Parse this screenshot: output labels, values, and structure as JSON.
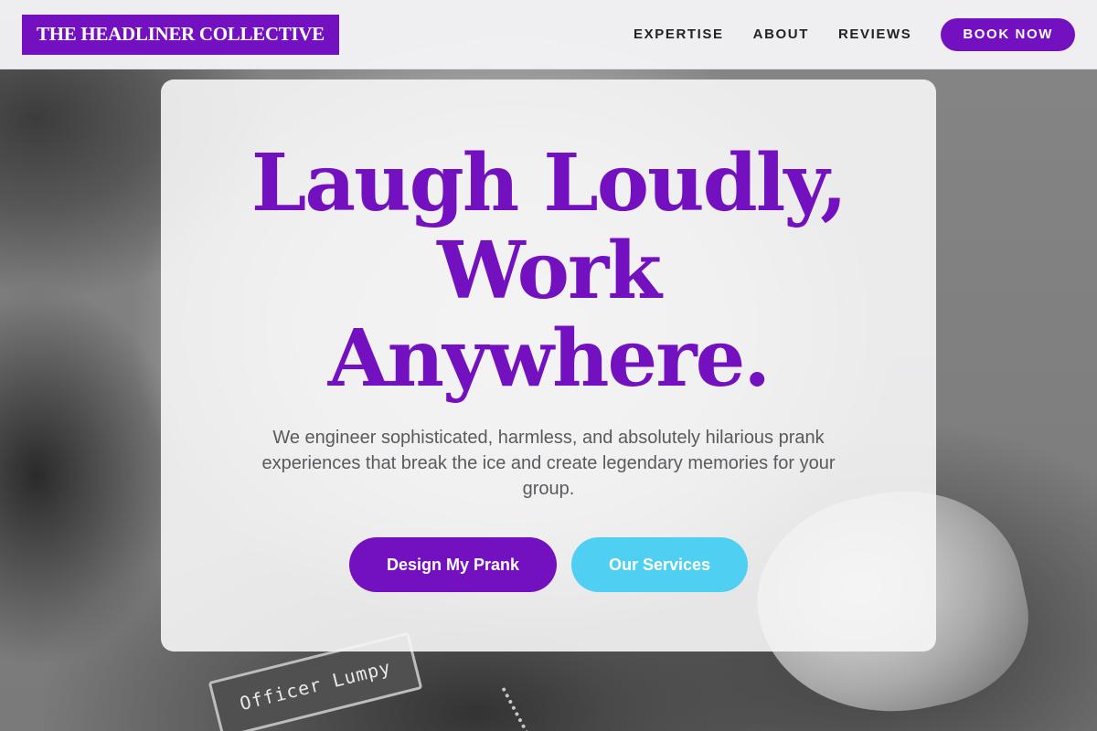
{
  "brand": {
    "name": "THE HEADLINER COLLECTIVE",
    "accent": "#7311c0",
    "secondary": "#4fd0f2"
  },
  "nav": {
    "links": [
      "EXPERTISE",
      "ABOUT",
      "REVIEWS"
    ],
    "cta": "BOOK NOW"
  },
  "hero": {
    "title_lines": [
      "Laugh Loudly,",
      "Work",
      "Anywhere."
    ],
    "subtitle": "We engineer sophisticated, harmless, and absolutely hilarious prank experiences that break the ice and create legendary memories for your group.",
    "primary_cta": "Design My Prank",
    "secondary_cta": "Our Services"
  },
  "background": {
    "nametag_text": "Officer Lumpy"
  }
}
